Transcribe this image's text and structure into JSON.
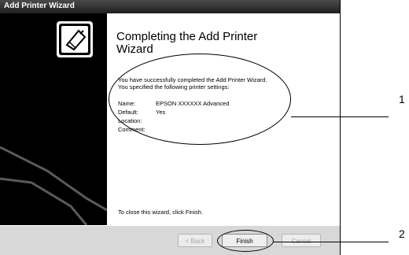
{
  "window": {
    "title": "Add Printer Wizard"
  },
  "content": {
    "heading": "Completing the Add Printer Wizard",
    "intro": "You have successfully completed the Add Printer Wizard. You specified the following printer settings:",
    "settings": [
      {
        "label": "Name:",
        "value": "EPSON XXXXXX Advanced"
      },
      {
        "label": "Default:",
        "value": "Yes"
      },
      {
        "label": "Location:",
        "value": ""
      },
      {
        "label": "Comment:",
        "value": ""
      }
    ],
    "closing": "To close this wizard, click Finish."
  },
  "buttons": {
    "back": "< Back",
    "finish": "Finish",
    "cancel": "Cancel"
  },
  "callouts": {
    "one": "1",
    "two": "2"
  }
}
